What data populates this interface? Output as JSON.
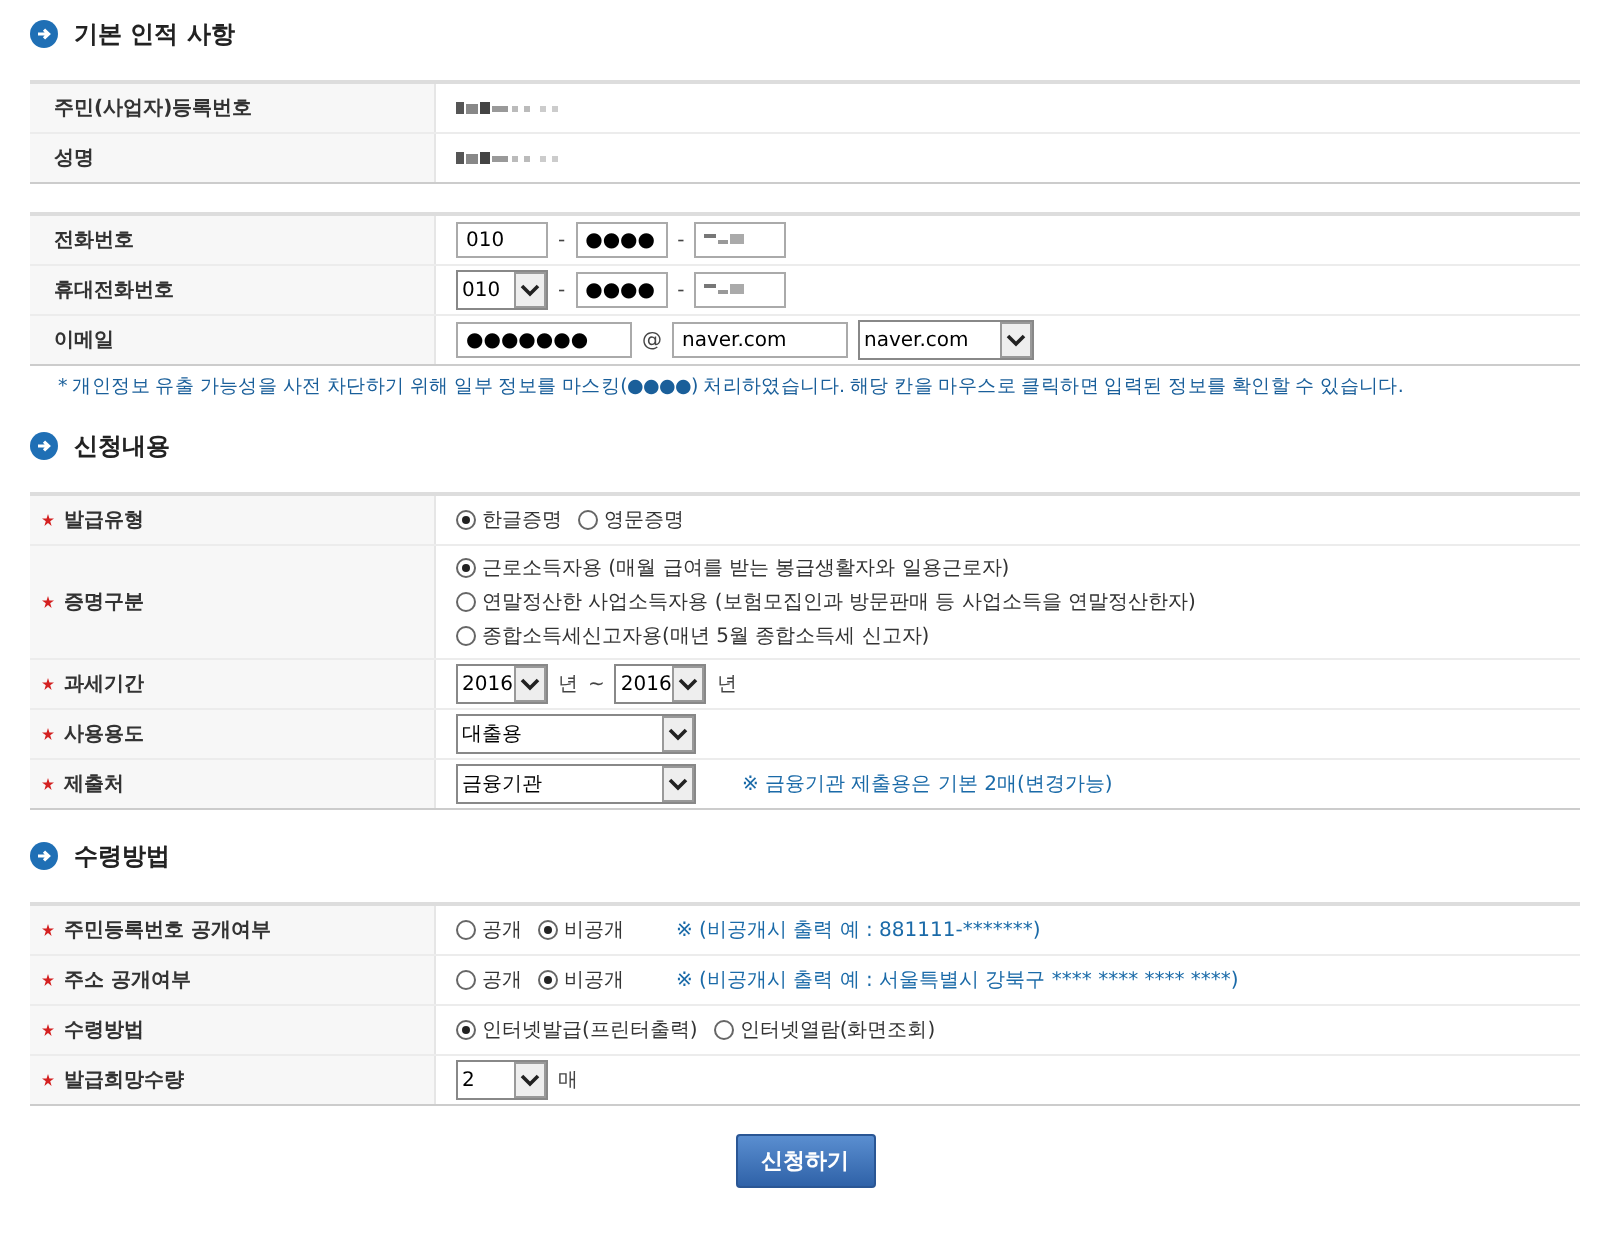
{
  "sections": [
    {
      "title": "기본 인적 사항",
      "tables": [
        {
          "rows": [
            {
              "label": "주민(사업자)등록번호",
              "kind": "inline",
              "controls": [
                {
                  "kind": "masked"
                }
              ]
            },
            {
              "label": "성명",
              "kind": "inline",
              "controls": [
                {
                  "kind": "masked"
                }
              ]
            }
          ]
        },
        {
          "rows": [
            {
              "label": "전화번호",
              "kind": "inline",
              "controls": [
                {
                  "kind": "short-input",
                  "value": "010"
                },
                {
                  "kind": "text",
                  "text": "-"
                },
                {
                  "kind": "short-input",
                  "value": "●●●●"
                },
                {
                  "kind": "text",
                  "text": "-"
                },
                {
                  "kind": "short-input",
                  "masked": true
                }
              ]
            },
            {
              "label": "휴대전화번호",
              "kind": "inline",
              "controls": [
                {
                  "kind": "short-select",
                  "value": "010"
                },
                {
                  "kind": "text",
                  "text": "-"
                },
                {
                  "kind": "short-input",
                  "value": "●●●●"
                },
                {
                  "kind": "text",
                  "text": "-"
                },
                {
                  "kind": "short-input",
                  "masked": true
                }
              ]
            },
            {
              "label": "이메일",
              "kind": "inline",
              "controls": [
                {
                  "kind": "input",
                  "value": "●●●●●●●"
                },
                {
                  "kind": "text",
                  "text": "@"
                },
                {
                  "kind": "input",
                  "value": "naver.com"
                },
                {
                  "kind": "select",
                  "value": "naver.com"
                }
              ]
            }
          ]
        }
      ],
      "notice": "* 개인정보 유출 가능성을 사전 차단하기 위해 일부 정보를 마스킹(●●●●) 처리하였습니다. 해당 칸을 마우스로 클릭하면 입력된 정보를 확인할 수 있습니다."
    },
    {
      "title": "신청내용",
      "tables": [
        {
          "rows": [
            {
              "label": "발급유형",
              "required": true,
              "kind": "inline",
              "controls": [
                {
                  "kind": "radio",
                  "label": "한글증명",
                  "selected": true
                },
                {
                  "kind": "radio",
                  "label": "영문증명",
                  "selected": false
                }
              ]
            },
            {
              "label": "증명구분",
              "required": true,
              "kind": "stacked",
              "controls": [
                {
                  "kind": "radio",
                  "label": "근로소득자용 (매월 급여를 받는 봉급생활자와 일용근로자)",
                  "selected": true
                },
                {
                  "kind": "radio",
                  "label": "연말정산한 사업소득자용 (보험모집인과 방문판매 등 사업소득을 연말정산한자)",
                  "selected": false
                },
                {
                  "kind": "radio",
                  "label": "종합소득세신고자용(매년 5월 종합소득세 신고자)",
                  "selected": false
                }
              ]
            },
            {
              "label": "과세기간",
              "required": true,
              "kind": "inline",
              "controls": [
                {
                  "kind": "short-select",
                  "value": "2016"
                },
                {
                  "kind": "text",
                  "text": "년"
                },
                {
                  "kind": "text",
                  "text": "~"
                },
                {
                  "kind": "short-select",
                  "value": "2016"
                },
                {
                  "kind": "text",
                  "text": "년"
                }
              ]
            },
            {
              "label": "사용용도",
              "required": true,
              "kind": "inline",
              "controls": [
                {
                  "kind": "long-select",
                  "value": "대출용"
                }
              ]
            },
            {
              "label": "제출처",
              "required": true,
              "kind": "inline",
              "controls": [
                {
                  "kind": "long-select",
                  "value": "금융기관"
                },
                {
                  "kind": "note",
                  "text": "※ 금융기관 제출용은 기본 2매(변경가능)"
                }
              ]
            }
          ]
        }
      ]
    },
    {
      "title": "수령방법",
      "tables": [
        {
          "rows": [
            {
              "label": "주민등록번호 공개여부",
              "required": true,
              "kind": "inline",
              "controls": [
                {
                  "kind": "radio",
                  "label": "공개",
                  "selected": false
                },
                {
                  "kind": "radio",
                  "label": "비공개",
                  "selected": true
                },
                {
                  "kind": "note",
                  "text": "※ (비공개시 출력 예 : 881111-*******)"
                }
              ]
            },
            {
              "label": "주소 공개여부",
              "required": true,
              "kind": "inline",
              "controls": [
                {
                  "kind": "radio",
                  "label": "공개",
                  "selected": false
                },
                {
                  "kind": "radio",
                  "label": "비공개",
                  "selected": true
                },
                {
                  "kind": "note",
                  "text": "※ (비공개시 출력 예 : 서울특별시 강북구 **** **** **** ****)"
                }
              ]
            },
            {
              "label": "수령방법",
              "required": true,
              "kind": "inline",
              "controls": [
                {
                  "kind": "radio",
                  "label": "인터넷발급(프린터출력)",
                  "selected": true
                },
                {
                  "kind": "radio",
                  "label": "인터넷열람(화면조회)",
                  "selected": false
                }
              ]
            },
            {
              "label": "발급희망수량",
              "required": true,
              "kind": "inline",
              "controls": [
                {
                  "kind": "short-select",
                  "value": "2"
                },
                {
                  "kind": "text",
                  "text": "매"
                }
              ]
            }
          ]
        }
      ]
    }
  ],
  "submit": "신청하기"
}
